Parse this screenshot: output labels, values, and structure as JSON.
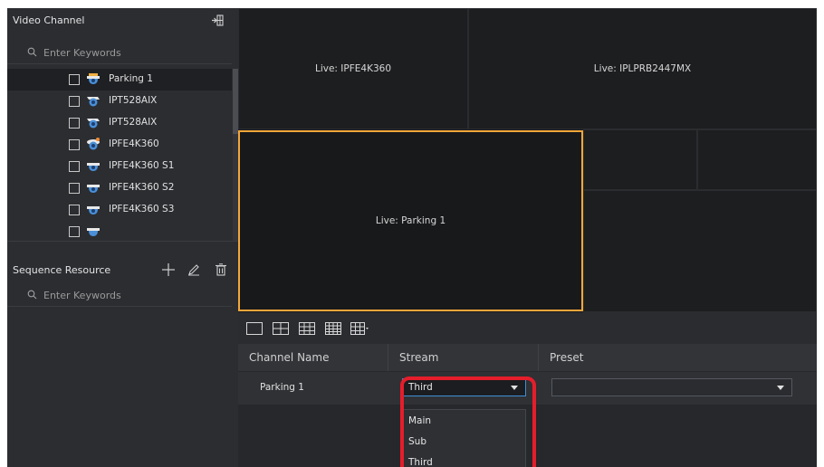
{
  "video_channel": {
    "title": "Video Channel",
    "search_placeholder": "Enter Keywords",
    "items": [
      {
        "label": "Parking 1",
        "selected": true
      },
      {
        "label": "IPT528AIX",
        "selected": false
      },
      {
        "label": "IPT528AIX",
        "selected": false
      },
      {
        "label": "IPFE4K360",
        "selected": false
      },
      {
        "label": "IPFE4K360 S1",
        "selected": false
      },
      {
        "label": "IPFE4K360 S2",
        "selected": false
      },
      {
        "label": "IPFE4K360 S3",
        "selected": false
      }
    ]
  },
  "sequence_resource": {
    "title": "Sequence Resource",
    "search_placeholder": "Enter Keywords"
  },
  "video_grid": {
    "tiles": [
      {
        "label": "Live: IPFE4K360"
      },
      {
        "label": "Live: IPLPRB2447MX"
      },
      {
        "label": "Live: Parking 1"
      }
    ]
  },
  "layout_toolbar": {
    "icons": [
      "layout-1x1-icon",
      "layout-2x2-icon",
      "layout-3x3-icon",
      "layout-4x4-icon",
      "layout-more-icon"
    ]
  },
  "channel_table": {
    "columns": [
      "Channel Name",
      "Stream",
      "Preset"
    ],
    "rows": [
      {
        "channel_name": "Parking 1",
        "stream": "Third",
        "preset": ""
      }
    ]
  },
  "stream_dropdown": {
    "options": [
      "Main",
      "Sub",
      "Third"
    ]
  },
  "colors": {
    "active_tile_border": "#f3a73b",
    "focus_border": "#3e8fd8",
    "annotation": "#e61d2b"
  }
}
